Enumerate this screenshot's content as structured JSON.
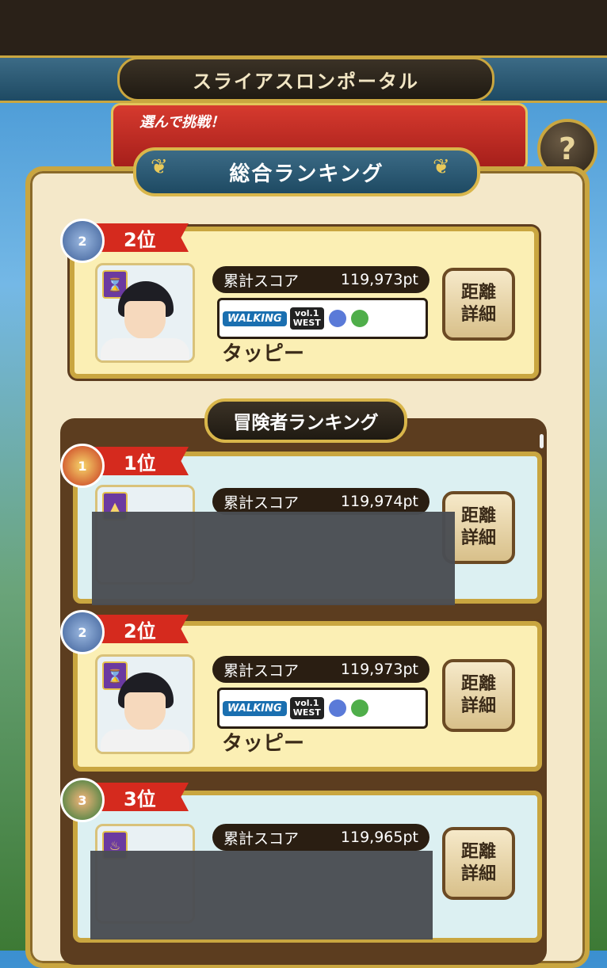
{
  "header": {
    "title": "スライアスロンポータル"
  },
  "banner": {
    "text": "選んで挑戦！"
  },
  "help": {
    "label": "?"
  },
  "panel": {
    "title": "総合ランキング"
  },
  "my_rank": {
    "rank": "2位",
    "score_label": "累計スコア",
    "score": "119,973pt",
    "name": "タッピー",
    "medal": "2",
    "distance_line1": "距離",
    "distance_line2": "詳細"
  },
  "section": {
    "title": "冒険者ランキング"
  },
  "event": {
    "logo": "WALKING",
    "vol": "vol.1",
    "region": "WEST"
  },
  "rankings": [
    {
      "rank": "1位",
      "medal": "1",
      "score_label": "累計スコア",
      "score": "119,974pt",
      "distance_line1": "距離",
      "distance_line2": "詳細"
    },
    {
      "rank": "2位",
      "medal": "2",
      "score_label": "累計スコア",
      "score": "119,973pt",
      "name": "タッピー",
      "distance_line1": "距離",
      "distance_line2": "詳細"
    },
    {
      "rank": "3位",
      "medal": "3",
      "score_label": "累計スコア",
      "score": "119,965pt",
      "distance_line1": "距離",
      "distance_line2": "詳細"
    }
  ]
}
